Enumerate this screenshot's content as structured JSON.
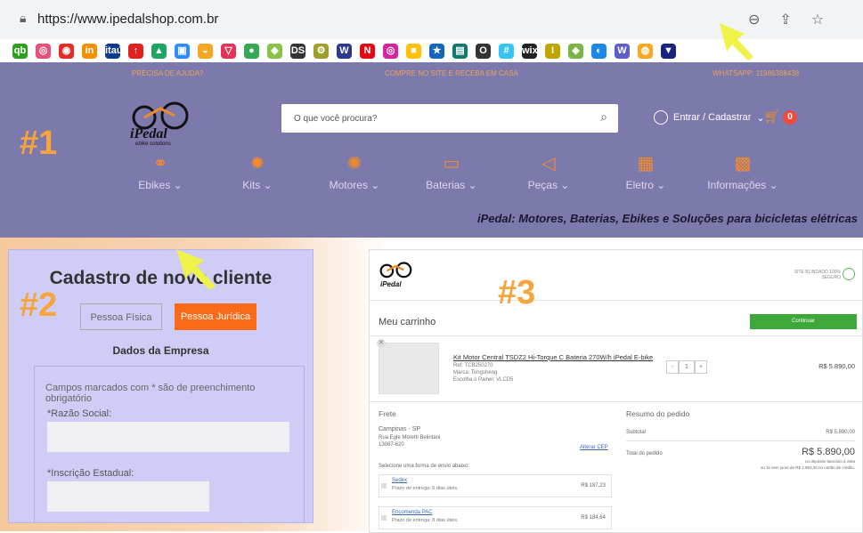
{
  "browser": {
    "url": "https://www.ipedalshop.com.br",
    "lock_icon": "lock-icon",
    "icons": [
      "zoom-icon",
      "share-icon",
      "star-icon"
    ]
  },
  "bookmarks": [
    {
      "label": "qb",
      "color": "#2ca01c"
    },
    {
      "label": "◎",
      "color": "#e8507a"
    },
    {
      "label": "◉",
      "color": "#e52d27"
    },
    {
      "label": "in",
      "color": "#f39100"
    },
    {
      "label": "itaú",
      "color": "#0d3a8e"
    },
    {
      "label": "↑",
      "color": "#e2201c"
    },
    {
      "label": "▲",
      "color": "#1fa463"
    },
    {
      "label": "▣",
      "color": "#2d8cff"
    },
    {
      "label": "◒",
      "color": "#f5a623"
    },
    {
      "label": "▽",
      "color": "#e6335a"
    },
    {
      "label": "●",
      "color": "#34a853"
    },
    {
      "label": "◆",
      "color": "#8bc34a"
    },
    {
      "label": "DS",
      "color": "#333333"
    },
    {
      "label": "⚙",
      "color": "#9e9e28"
    },
    {
      "label": "W",
      "color": "#2b3990"
    },
    {
      "label": "N",
      "color": "#e50914"
    },
    {
      "label": "◎",
      "color": "#d6249f"
    },
    {
      "label": "■",
      "color": "#ffc107"
    },
    {
      "label": "★",
      "color": "#1565c0"
    },
    {
      "label": "▤",
      "color": "#0f7b6c"
    },
    {
      "label": "O",
      "color": "#333333"
    },
    {
      "label": "#",
      "color": "#36c5f0"
    },
    {
      "label": "wix",
      "color": "#222222"
    },
    {
      "label": "I",
      "color": "#c0a500"
    },
    {
      "label": "◈",
      "color": "#7cb342"
    },
    {
      "label": "◐",
      "color": "#1e88e5"
    },
    {
      "label": "W",
      "color": "#5b5fc7"
    },
    {
      "label": "◍",
      "color": "#f9a825"
    },
    {
      "label": "▼",
      "color": "#1a237e"
    }
  ],
  "header": {
    "topstrip": {
      "help": "PRECISA DE AJUDA?",
      "promo": "COMPRE NO SITE E RECEBA EM CASA",
      "whatsapp": "WHATSAPP: 11986388438"
    },
    "logo_text": "iPedal",
    "logo_sub": "ebike solutions",
    "search_placeholder": "O que você procura?",
    "account_label": "Entrar / Cadastrar",
    "cart_count": "0",
    "tagline": "iPedal: Motores, Baterias, Ebikes e Soluções para bicicletas elétricas",
    "nav": [
      {
        "label": "Ebikes",
        "icon": "bike-icon"
      },
      {
        "label": "Kits",
        "icon": "gear-icon"
      },
      {
        "label": "Motores",
        "icon": "motor-icon"
      },
      {
        "label": "Baterias",
        "icon": "battery-icon"
      },
      {
        "label": "Peças",
        "icon": "frame-icon"
      },
      {
        "label": "Eletro",
        "icon": "display-icon"
      },
      {
        "label": "Informações",
        "icon": "info-icon"
      }
    ]
  },
  "labels": {
    "one": "#1",
    "two": "#2",
    "three": "#3"
  },
  "signup": {
    "title": "Cadastro de novo cliente",
    "tab_pf": "Pessoa Física",
    "tab_pj": "Pessoa Jurídica",
    "section": "Dados da Empresa",
    "note": "Campos marcados com * são de preenchimento obrigatório",
    "field1": "*Razão Social:",
    "field2": "*Inscrição Estadual:"
  },
  "checkout": {
    "logo_text": "iPedal",
    "secure": "SITE BLINDADO 100% SEGURO",
    "cart_title": "Meu carrinho",
    "continue": "Continuar",
    "product": {
      "name": "Kit Motor Central TSDZ2 Hi-Torque C Bateria 270W/h iPedal E-bike",
      "ref": "Ref: TCB250270",
      "brand": "Marca: Tongsheng",
      "option": "Escolha o Painel: VLCD5",
      "qty": "1",
      "price": "R$ 5.890,00"
    },
    "shipping": {
      "title": "Frete",
      "city": "Campinas - SP",
      "street": "Rua Egle Moretti Belintani",
      "zip": "13087-620",
      "change": "Alterar CEP",
      "select": "Selecione uma forma de envio abaixo:",
      "options": [
        {
          "name": "Sedex",
          "eta": "Prazo de entrega: 5 dias úteis.",
          "price": "R$ 187,23"
        },
        {
          "name": "Encomenda PAC",
          "eta": "Prazo de entrega: 8 dias úteis.",
          "price": "R$ 184,64"
        }
      ]
    },
    "summary": {
      "title": "Resumo do pedido",
      "subtotal_label": "Subtotal",
      "subtotal": "R$ 5.890,00",
      "total_label": "Total do pedido",
      "total": "R$ 5.890,00",
      "note1": "no depósito bancário à vista",
      "note2": "ou 3x sem juros de R$ 1.963,33 no cartão de crédito."
    }
  },
  "colors": {
    "accent": "#fb6a18",
    "header_bg": "#7c79ad",
    "label_orange": "#f6a43b",
    "green": "#3fa83a"
  }
}
